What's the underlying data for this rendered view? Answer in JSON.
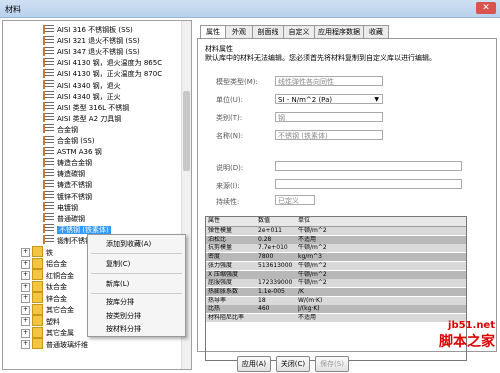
{
  "window": {
    "title": "材料",
    "close": "✕"
  },
  "tree": {
    "materials": [
      "AISI 316 不锈钢板 (SS)",
      "AISI 321 退火不锈钢 (SS)",
      "AISI 347 退火不锈钢 (SS)",
      "AISI 4130 钢，退火温度为 865C",
      "AISI 4130 钢，正火温度为 870C",
      "AISI 4340 钢，退火",
      "AISI 4340 钢，正火",
      "AISI 类型 316L 不锈钢",
      "AISI 类型 A2 刀具钢",
      "合金钢",
      "合金钢 (SS)",
      "ASTM A36 钢",
      "铸造合金钢",
      "铸造碳钢",
      "铸造不锈钢",
      "镀锌不锈钢",
      "电镀钢",
      "普通碳钢"
    ],
    "selected": "不锈钢 (铁素体)",
    "after_selected": "锻制不锈钢",
    "categories": [
      "铁",
      "铝合金",
      "红铜合金",
      "钛合金",
      "锌合金",
      "其它合金",
      "塑料",
      "其它金属",
      "普通玻璃纤维"
    ]
  },
  "context_menu": {
    "add_favorite": "添加到收藏(A)",
    "copy": "复制(C)",
    "new_library": "新库(L)",
    "sort_by_library": "按库分排",
    "sort_by_category": "按类别分排",
    "sort_by_material": "按材料分排"
  },
  "tabs": [
    "属性",
    "外观",
    "剖面线",
    "自定义",
    "应用程序数据",
    "收藏"
  ],
  "panel": {
    "group": "材料属性",
    "notice": "默认库中的材料无法编辑。您必须首先将材料复制到自定义库以进行编辑。",
    "model_type_label": "模型类型(M):",
    "model_type_value": "线性弹性各向同性",
    "unit_label": "单位(U):",
    "unit_value": "SI - N/m^2 (Pa)",
    "category_label": "类别(T):",
    "category_value": "钢",
    "name_label": "名称(N):",
    "name_value": "不锈钢 (铁素体)",
    "desc_label": "说明(D):",
    "source_label": "来源(I):",
    "sustain_label": "持续性:",
    "sustain_value": "已定义"
  },
  "table": {
    "headers": [
      "属性",
      "数值",
      "单位"
    ],
    "rows": [
      [
        "弹性模量",
        "2e+011",
        "牛顿/m^2"
      ],
      [
        "泊松比",
        "0.28",
        "不适用"
      ],
      [
        "抗剪模量",
        "7.7e+010",
        "牛顿/m^2"
      ],
      [
        "密度",
        "7800",
        "kg/m^3"
      ],
      [
        "张力强度",
        "513613000",
        "牛顿/m^2"
      ],
      [
        "X 压缩强度",
        "",
        "牛顿/m^2"
      ],
      [
        "屈服强度",
        "172339000",
        "牛顿/m^2"
      ],
      [
        "热膨胀系数",
        "1.1e-005",
        "/K"
      ],
      [
        "热导率",
        "18",
        "W/(m·K)"
      ],
      [
        "比热",
        "460",
        "J/(kg·K)"
      ],
      [
        "材料阻尼比率",
        "",
        "不适用"
      ]
    ]
  },
  "buttons": {
    "apply": "应用(A)",
    "close": "关闭(C)",
    "save": "保存(S)"
  },
  "watermark": {
    "line1": "jb51.net",
    "line2": "脚本之家"
  }
}
